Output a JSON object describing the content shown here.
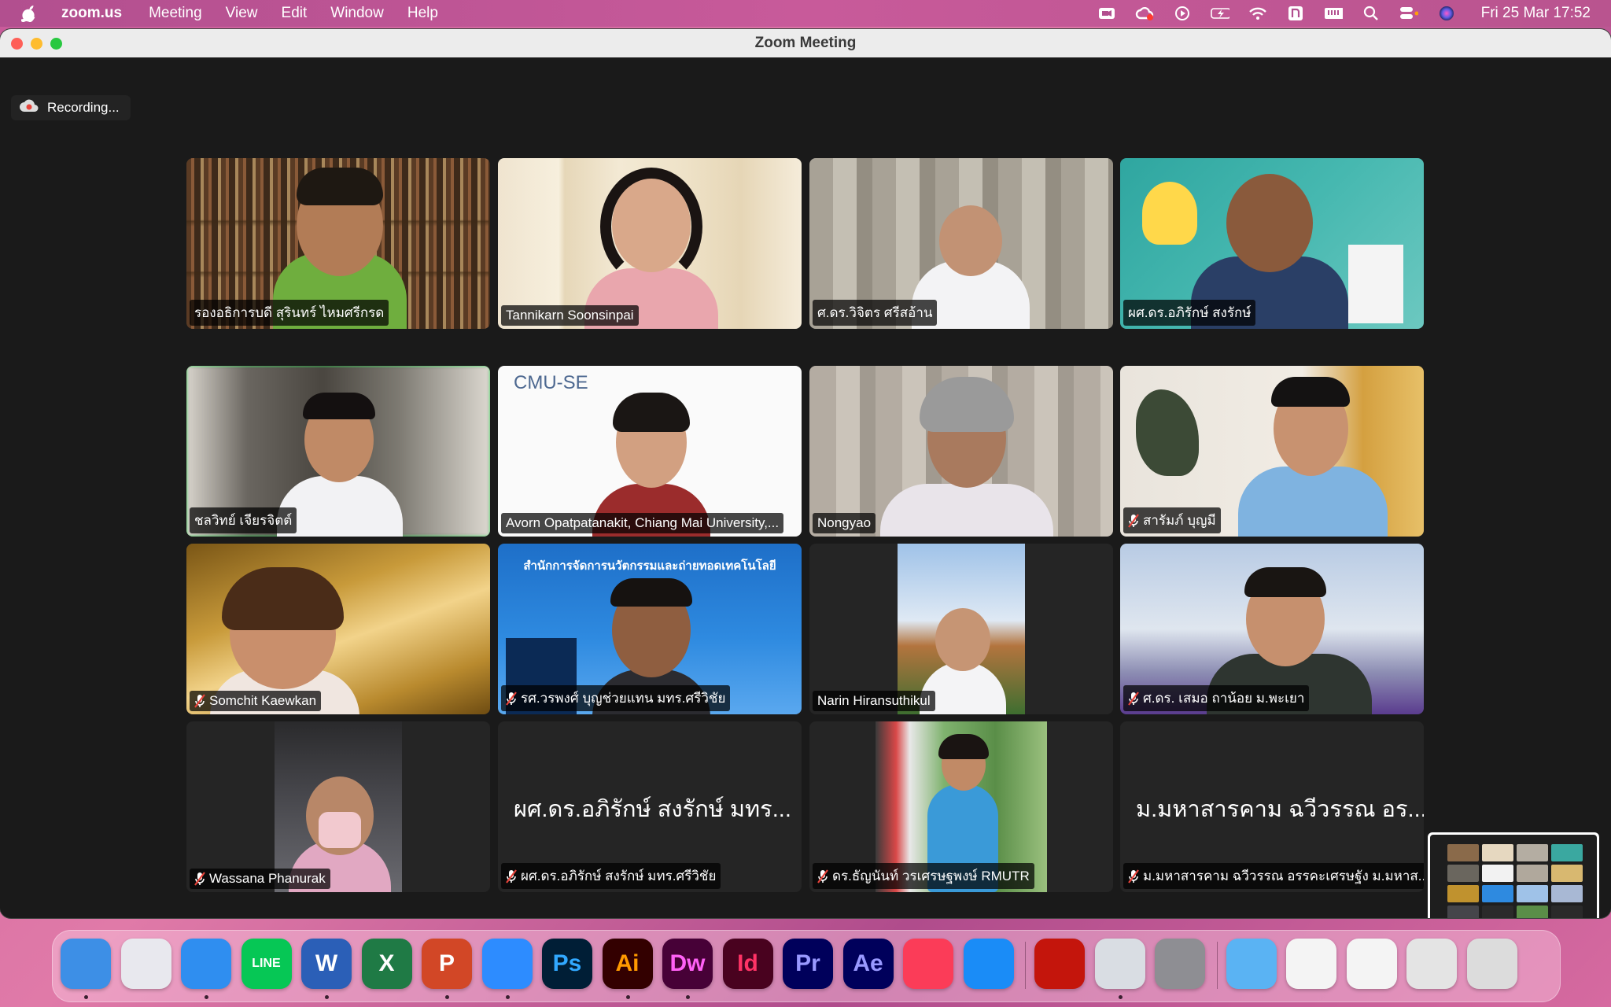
{
  "menubar": {
    "app_name": "zoom.us",
    "items": [
      "Meeting",
      "View",
      "Edit",
      "Window",
      "Help"
    ],
    "clock": "Fri 25 Mar  17:52"
  },
  "window": {
    "title": "Zoom Meeting",
    "recording_label": "Recording..."
  },
  "participants": [
    {
      "name": "รองอธิการบดี สุรินทร์ ไหมศรีกรด",
      "muted": false,
      "video": true
    },
    {
      "name": "Tannikarn Soonsinpai",
      "muted": false,
      "video": true
    },
    {
      "name": "ศ.ดร.วิจิตร ศรีสอ้าน",
      "muted": false,
      "video": true
    },
    {
      "name": "ผศ.ดร.อภิรักษ์ สงรักษ์",
      "muted": false,
      "video": true
    },
    {
      "name": "ชลวิทย์ เจียรจิตต์",
      "muted": false,
      "video": true,
      "active_speaker": true
    },
    {
      "name": "Avorn Opatpatanakit, Chiang Mai University,...",
      "muted": false,
      "video": true,
      "background_text": "CMU-SE"
    },
    {
      "name": "Nongyao",
      "muted": false,
      "video": true
    },
    {
      "name": "สารัมภ์ บุญมี",
      "muted": true,
      "video": true
    },
    {
      "name": "Somchit Kaewkan",
      "muted": true,
      "video": true
    },
    {
      "name": "รศ.วรพงศ์ บุญช่วยแทน มทร.ศรีวิชัย",
      "muted": true,
      "video": true,
      "background_text": "สำนักการจัดการนวัตกรรมและถ่ายทอดเทคโนโลยี"
    },
    {
      "name": "Narin Hiransuthikul",
      "muted": false,
      "video": true
    },
    {
      "name": "ศ.ดร. เสมอ ถาน้อย ม.พะเยา",
      "muted": true,
      "video": true
    },
    {
      "name": "Wassana Phanurak",
      "muted": true,
      "video": true
    },
    {
      "name": "ผศ.ดร.อภิรักษ์  สงรักษ์ มทร.ศรีวิชัย",
      "muted": true,
      "video": false,
      "display": "ผศ.ดร.อภิรักษ์  สงรักษ์ มทร..."
    },
    {
      "name": "ดร.ธัญนันท์ วรเศรษฐพงษ์ RMUTR",
      "muted": true,
      "video": true
    },
    {
      "name": "ม.มหาสารคาม ฉวีวรรณ อรรคะเศรษฐัง ม.มหาส...",
      "muted": true,
      "video": false,
      "display": "ม.มหาสารคาม ฉวีวรรณ อร..."
    }
  ],
  "dock": {
    "apps": [
      {
        "name": "finder",
        "label": "",
        "color": "#3d8fe6"
      },
      {
        "name": "launchpad",
        "label": "",
        "color": "#e8e8ee"
      },
      {
        "name": "safari",
        "label": "",
        "color": "#2f8ef0"
      },
      {
        "name": "line",
        "label": "LINE",
        "color": "#06c755"
      },
      {
        "name": "word",
        "label": "W",
        "color": "#2b5fb7"
      },
      {
        "name": "excel",
        "label": "X",
        "color": "#1f7a45"
      },
      {
        "name": "powerpoint",
        "label": "P",
        "color": "#d24726"
      },
      {
        "name": "zoom",
        "label": "",
        "color": "#2d8cff"
      },
      {
        "name": "photoshop",
        "label": "Ps",
        "color": "#001e36",
        "text": "#31a8ff"
      },
      {
        "name": "illustrator",
        "label": "Ai",
        "color": "#330000",
        "text": "#ff9a00"
      },
      {
        "name": "dreamweaver",
        "label": "Dw",
        "color": "#470137",
        "text": "#ff61f6"
      },
      {
        "name": "indesign",
        "label": "Id",
        "color": "#49021f",
        "text": "#ff3366"
      },
      {
        "name": "premiere",
        "label": "Pr",
        "color": "#00005b",
        "text": "#9999ff"
      },
      {
        "name": "after-effects",
        "label": "Ae",
        "color": "#00005b",
        "text": "#9999ff"
      },
      {
        "name": "music",
        "label": "",
        "color": "#fb3c58"
      },
      {
        "name": "app-store",
        "label": "",
        "color": "#1a8cf7"
      },
      {
        "name": "acrobat",
        "label": "",
        "color": "#c4150c"
      },
      {
        "name": "preview",
        "label": "",
        "color": "#d9dde3"
      },
      {
        "name": "system-preferences",
        "label": "",
        "color": "#8e8e93"
      },
      {
        "name": "folder",
        "label": "",
        "color": "#5ab3f3"
      },
      {
        "name": "document-thumb-1",
        "label": "",
        "color": "#f4f4f4"
      },
      {
        "name": "document-thumb-2",
        "label": "",
        "color": "#f4f4f4"
      },
      {
        "name": "document-thumb-3",
        "label": "",
        "color": "#e4e4e4"
      },
      {
        "name": "trash",
        "label": "",
        "color": "#dcdcdc"
      }
    ]
  }
}
